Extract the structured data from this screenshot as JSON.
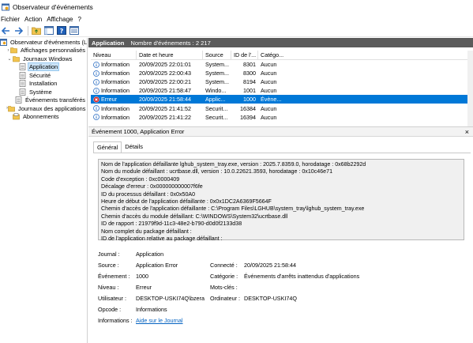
{
  "window": {
    "title": "Observateur d'événements"
  },
  "menu": [
    "Fichier",
    "Action",
    "Affichage",
    "?"
  ],
  "tree": [
    {
      "label": "Observateur d'événements (Loc...",
      "arrow": "",
      "indent": 0,
      "icon": "event-viewer-icon"
    },
    {
      "label": "Affichages personnalisés",
      "arrow": "›",
      "indent": 1,
      "icon": "folder-icon"
    },
    {
      "label": "Journaux Windows",
      "arrow": "⌄",
      "indent": 1,
      "icon": "folder-icon"
    },
    {
      "label": "Application",
      "arrow": "",
      "indent": 2,
      "icon": "log-icon",
      "selected": true
    },
    {
      "label": "Sécurité",
      "arrow": "",
      "indent": 2,
      "icon": "log-icon"
    },
    {
      "label": "Installation",
      "arrow": "",
      "indent": 2,
      "icon": "log-icon"
    },
    {
      "label": "Système",
      "arrow": "",
      "indent": 2,
      "icon": "log-icon"
    },
    {
      "label": "Événements transférés",
      "arrow": "",
      "indent": 2,
      "icon": "log-icon"
    },
    {
      "label": "Journaux des applications et...",
      "arrow": "›",
      "indent": 1,
      "icon": "folder-icon"
    },
    {
      "label": "Abonnements",
      "arrow": "",
      "indent": 1,
      "icon": "subscriptions-icon"
    }
  ],
  "panel": {
    "title": "Application",
    "count_text": "Nombre d'événements : 2 217"
  },
  "table": {
    "headers": [
      "Niveau",
      "Date et heure",
      "Source",
      "ID de l'...",
      "Catégo..."
    ],
    "rows": [
      {
        "level": "Information",
        "date": "20/09/2025 22:01:01",
        "source": "System...",
        "id": "8301",
        "cat": "Aucun",
        "type": "info"
      },
      {
        "level": "Information",
        "date": "20/09/2025 22:00:43",
        "source": "System...",
        "id": "8300",
        "cat": "Aucun",
        "type": "info"
      },
      {
        "level": "Information",
        "date": "20/09/2025 22:00:21",
        "source": "System...",
        "id": "8194",
        "cat": "Aucun",
        "type": "info"
      },
      {
        "level": "Information",
        "date": "20/09/2025 21:58:47",
        "source": "Windo...",
        "id": "1001",
        "cat": "Aucun",
        "type": "info"
      },
      {
        "level": "Erreur",
        "date": "20/09/2025 21:58:44",
        "source": "Applic...",
        "id": "1000",
        "cat": "Évène...",
        "type": "error",
        "selected": true
      },
      {
        "level": "Information",
        "date": "20/09/2025 21:41:52",
        "source": "Securit...",
        "id": "16384",
        "cat": "Aucun",
        "type": "info"
      },
      {
        "level": "Information",
        "date": "20/09/2025 21:41:22",
        "source": "Securit...",
        "id": "16394",
        "cat": "Aucun",
        "type": "info"
      }
    ]
  },
  "detail": {
    "title": "Événement 1000, Application Error",
    "close": "×",
    "tabs": [
      "Général",
      "Détails"
    ],
    "message": [
      "Nom de l'application défaillante lghub_system_tray.exe, version : 2025.7.8359.0, horodatage : 0x68b2292d",
      "Nom du module défaillant : ucrtbase.dll, version : 10.0.22621.3593, horodatage : 0x10c46e71",
      "Code d'exception : 0xc0000409",
      "Décalage d'erreur : 0x000000000007f6fe",
      "ID du processus défaillant : 0x0x50A0",
      "Heure de début de l'application défaillante : 0x0x1DC2A6369F5664F",
      "Chemin d'accès de l'application défaillante : C:\\Program Files\\LGHUB\\system_tray\\lghub_system_tray.exe",
      "Chemin d'accès du module défaillant: C:\\WINDOWS\\System32\\ucrtbase.dll",
      "ID de rapport : 21979f9d-11c3-48e2-b790-d0d0f2133d38",
      "Nom complet du package défaillant :",
      "ID de l'application relative au package défaillant :"
    ],
    "props": {
      "journal_label": "Journal :",
      "journal": "Application",
      "source_label": "Source :",
      "source": "Application Error",
      "connecte_label": "Connecté :",
      "connecte": "20/09/2025 21:58:44",
      "evenement_label": "Événement :",
      "evenement": "1000",
      "categorie_label": "Catégorie :",
      "categorie": "Événements d'arrêts inattendus d'applications",
      "niveau_label": "Niveau :",
      "niveau": "Erreur",
      "motscles_label": "Mots-clés :",
      "motscles": "",
      "utilisateur_label": "Utilisateur :",
      "utilisateur": "DESKTOP-USKI74Q\\bzera",
      "ordinateur_label": "Ordinateur :",
      "ordinateur": "DESKTOP-USKI74Q",
      "opcode_label": "Opcode :",
      "opcode": "Informations",
      "informations_label": "Informations :",
      "informations_link": "Aide sur le Journal"
    }
  }
}
